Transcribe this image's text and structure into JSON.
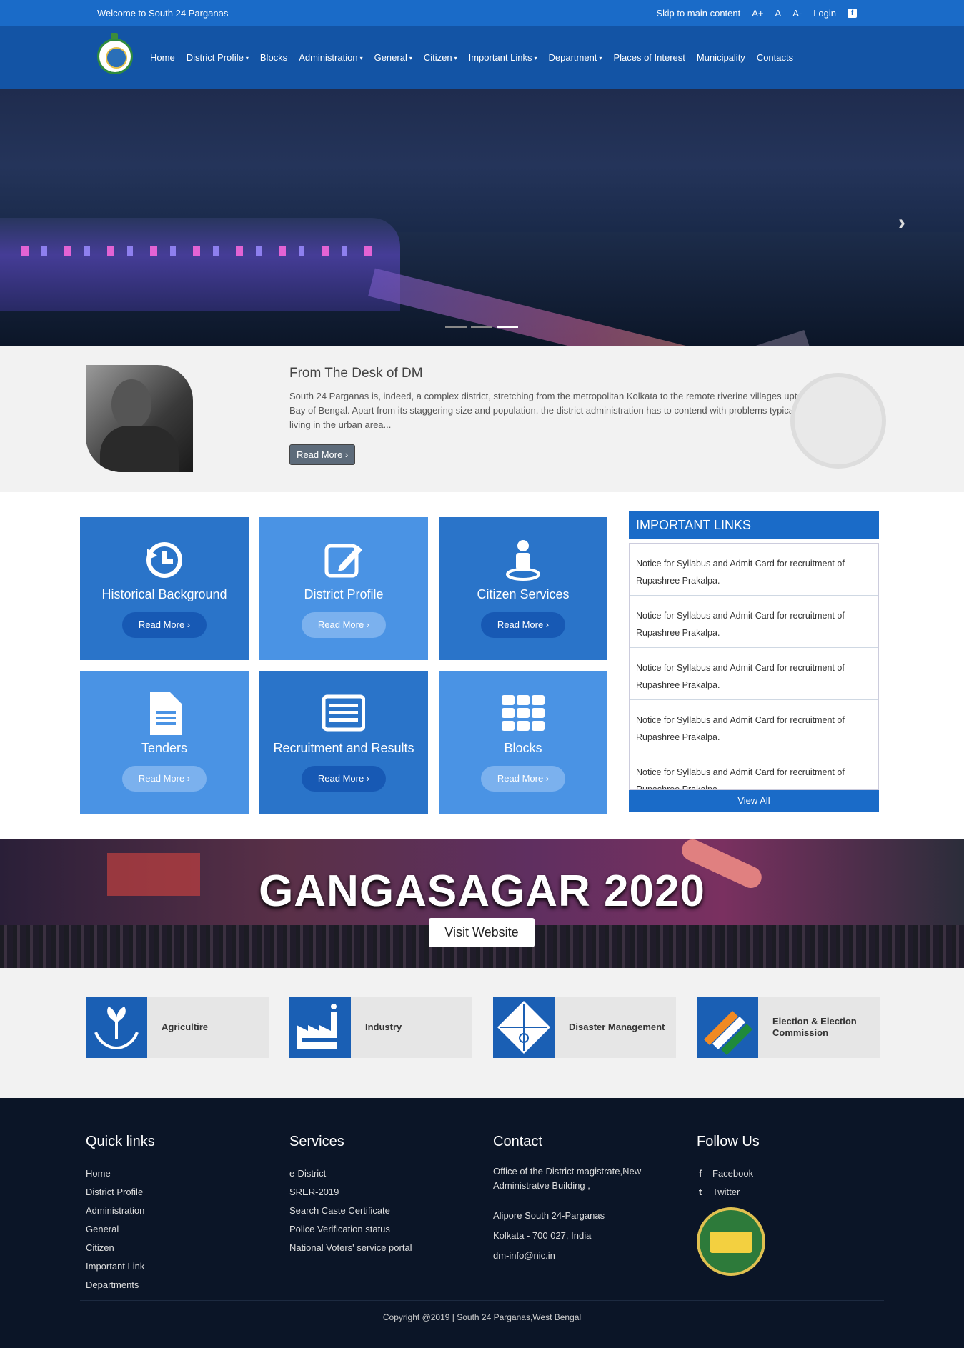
{
  "topbar": {
    "welcome": "Welcome to South 24 Parganas",
    "skip": "Skip to main content",
    "font_plus": "A+",
    "font_normal": "A",
    "font_minus": "A-",
    "login": "Login",
    "facebook_glyph": "f"
  },
  "nav": {
    "items": [
      {
        "label": "Home",
        "dropdown": false
      },
      {
        "label": "District Profile",
        "dropdown": true
      },
      {
        "label": "Blocks",
        "dropdown": false
      },
      {
        "label": "Administration",
        "dropdown": true
      },
      {
        "label": "General",
        "dropdown": true
      },
      {
        "label": "Citizen",
        "dropdown": true
      },
      {
        "label": "Important Links",
        "dropdown": true
      },
      {
        "label": "Department",
        "dropdown": true
      },
      {
        "label": "Places of Interest",
        "dropdown": false
      },
      {
        "label": "Municipality",
        "dropdown": false
      },
      {
        "label": "Contacts",
        "dropdown": false
      }
    ],
    "caret": "▾"
  },
  "hero": {
    "next_icon": "›",
    "slides": 3,
    "active_slide": 3
  },
  "desk": {
    "title": "From The Desk of DM",
    "text": "South 24 Parganas is, indeed, a complex district, stretching from the metropolitan Kolkata to the remote riverine villages upto the mouth of Bay of Bengal. Apart from its staggering size and population, the district administration has to contend with problems typical of metropolitan living in the urban area...",
    "button": "Read More ›"
  },
  "tiles": [
    {
      "title": "Historical Background",
      "button": "Read More ›",
      "icon": "history-icon"
    },
    {
      "title": "District Profile",
      "button": "Read More ›",
      "icon": "edit-icon"
    },
    {
      "title": "Citizen Services",
      "button": "Read More ›",
      "icon": "user-pin-icon"
    },
    {
      "title": "Tenders",
      "button": "Read More ›",
      "icon": "document-icon"
    },
    {
      "title": "Recruitment and Results",
      "button": "Read More ›",
      "icon": "list-icon"
    },
    {
      "title": "Blocks",
      "button": "Read More ›",
      "icon": "grid-icon"
    }
  ],
  "important_links": {
    "title": "IMPORTANT LINKS",
    "items": [
      "Notice for Syllabus and Admit Card for recruitment of Rupashree Prakalpa.",
      "Notice for Syllabus and Admit Card for recruitment of Rupashree Prakalpa.",
      "Notice for Syllabus and Admit Card for recruitment of Rupashree Prakalpa.",
      "Notice for Syllabus and Admit Card for recruitment of Rupashree Prakalpa.",
      "Notice for Syllabus and Admit Card for recruitment of Rupashree Prakalpa."
    ],
    "view_all": "View All"
  },
  "banner": {
    "title": "GANGASAGAR 2020",
    "button": "Visit Website"
  },
  "departments": [
    {
      "label": "Agricultire",
      "icon": "plant-hands-icon"
    },
    {
      "label": "Industry",
      "icon": "factory-icon"
    },
    {
      "label": "Disaster Management",
      "icon": "disaster-icon"
    },
    {
      "label": "Election & Election Commission",
      "icon": "ballot-icon"
    }
  ],
  "footer": {
    "quick_links": {
      "title": "Quick links",
      "items": [
        "Home",
        "District Profile",
        "Administration",
        "General",
        "Citizen",
        "Important Link",
        "Departments"
      ]
    },
    "services": {
      "title": "Services",
      "items": [
        "e-District",
        "SRER-2019",
        "Search Caste Certificate",
        "Police Verification status",
        "National Voters' service portal"
      ]
    },
    "contact": {
      "title": "Contact",
      "line1": "Office of the District magistrate,New Administratve Building ,",
      "line2": "Alipore South 24-Parganas",
      "line3": "Kolkata - 700 027, India",
      "email": "dm-info@nic.in"
    },
    "follow": {
      "title": "Follow Us",
      "facebook": "Facebook",
      "twitter": "Twitter",
      "facebook_glyph": "f",
      "twitter_glyph": "t"
    },
    "copyright": "Copyright @2019 | South 24 Parganas,West Bengal"
  }
}
